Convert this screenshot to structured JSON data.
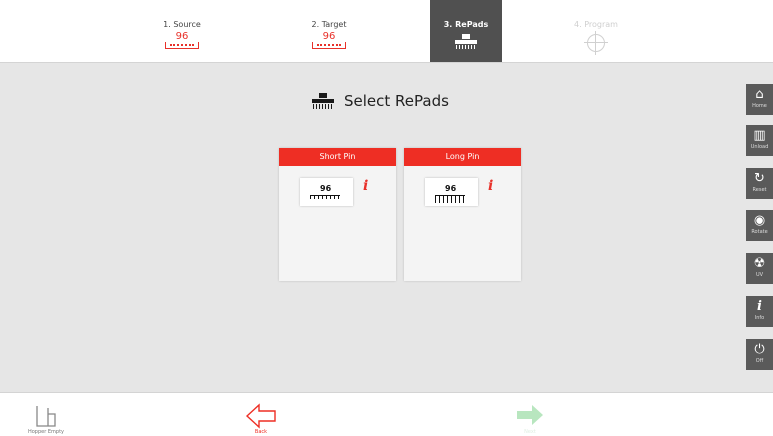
{
  "steps": [
    {
      "label": "1. Source",
      "value": "96",
      "state": "done"
    },
    {
      "label": "2. Target",
      "value": "96",
      "state": "done"
    },
    {
      "label": "3. RePads",
      "value": "",
      "state": "active"
    },
    {
      "label": "4. Program",
      "value": "",
      "state": "disabled"
    }
  ],
  "main": {
    "title": "Select RePads",
    "icon": "repad-icon",
    "cards": [
      {
        "header": "Short Pin",
        "count": "96",
        "info_icon": "info-icon",
        "info_label": "i"
      },
      {
        "header": "Long Pin",
        "count": "96",
        "info_icon": "info-icon",
        "info_label": "i"
      }
    ]
  },
  "sidebar": [
    {
      "icon": "home-icon",
      "glyph": "⌂",
      "label": "Home"
    },
    {
      "icon": "unload-icon",
      "glyph": "▥",
      "label": "Unload"
    },
    {
      "icon": "reset-icon",
      "glyph": "↻",
      "label": "Reset"
    },
    {
      "icon": "rotate-icon",
      "glyph": "◉",
      "label": "Rotate"
    },
    {
      "icon": "uv-icon",
      "glyph": "☢",
      "label": "UV"
    },
    {
      "icon": "info-icon",
      "glyph": "i",
      "label": "Info"
    },
    {
      "icon": "power-icon",
      "glyph": "⏻",
      "label": "Off"
    }
  ],
  "bottom": {
    "hopper": {
      "label": "Hopper Empty",
      "icon": "hopper-icon"
    },
    "back": {
      "label": "Back",
      "icon": "back-arrow-icon"
    },
    "next": {
      "label": "Next",
      "icon": "next-arrow-icon"
    }
  },
  "colors": {
    "accent": "#ee2e24",
    "active_step": "#505050",
    "next_disabled": "#b8e6bf"
  }
}
